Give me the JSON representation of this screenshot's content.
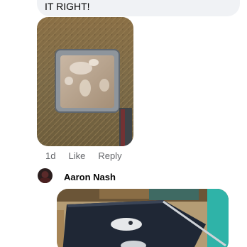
{
  "comment1": {
    "text_tail": "IT RIGHT!",
    "time": "1d",
    "like_label": "Like",
    "reply_label": "Reply"
  },
  "comment2": {
    "author": "Aaron Nash"
  }
}
